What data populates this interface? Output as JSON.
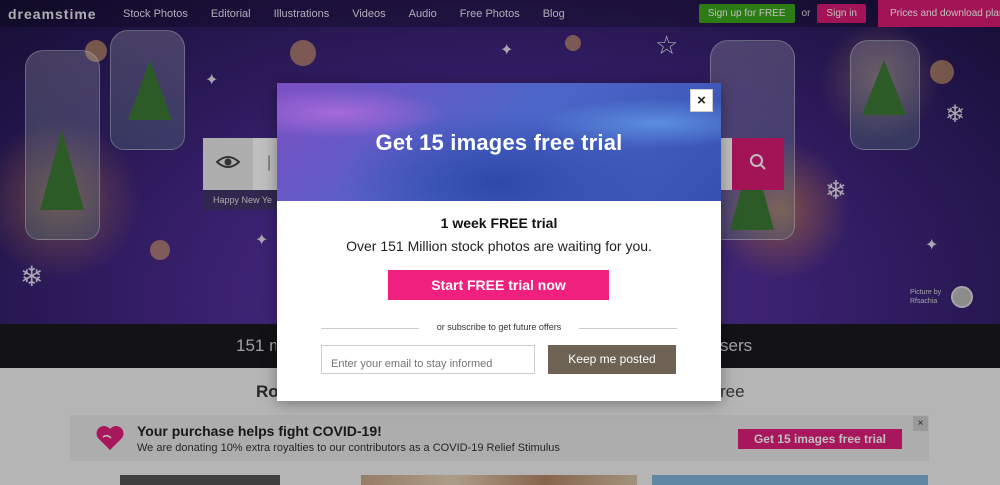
{
  "brand": {
    "logo_text": "dreamstime"
  },
  "nav": {
    "items": [
      "Stock Photos",
      "Editorial",
      "Illustrations",
      "Videos",
      "Audio",
      "Free Photos",
      "Blog"
    ],
    "signup_label": "Sign up for FREE",
    "or_label": "or",
    "signin_label": "Sign in",
    "prices_label": "Prices and download plans"
  },
  "search": {
    "partial_text": "|",
    "hint_text": "Happy New Ye"
  },
  "credit": {
    "line1": "Picture by",
    "line2": "Rfsachia"
  },
  "stats": {
    "left_text": "151 m",
    "right_text": "sers"
  },
  "below": {
    "left_text": "Ro",
    "right_text": "ree"
  },
  "covid": {
    "title": "Your purchase helps fight COVID-19!",
    "subtitle": "We are donating 10% extra royalties to our contributors as a COVID-19 Relief Stimulus",
    "cta_label": "Get 15 images free trial",
    "close_label": "×"
  },
  "modal": {
    "title": "Get 15 images free trial",
    "close_label": "×",
    "heading": "1 week FREE trial",
    "description": "Over 151 Million stock photos are waiting for you.",
    "cta_label": "Start FREE trial now",
    "divider_text": "or subscribe to get future offers",
    "email_placeholder": "Enter your email to stay informed",
    "keep_label": "Keep me posted"
  },
  "colors": {
    "brand_pink": "#e01f7a",
    "signup_green": "#3aa61d",
    "keep_brown": "#6e6255"
  }
}
